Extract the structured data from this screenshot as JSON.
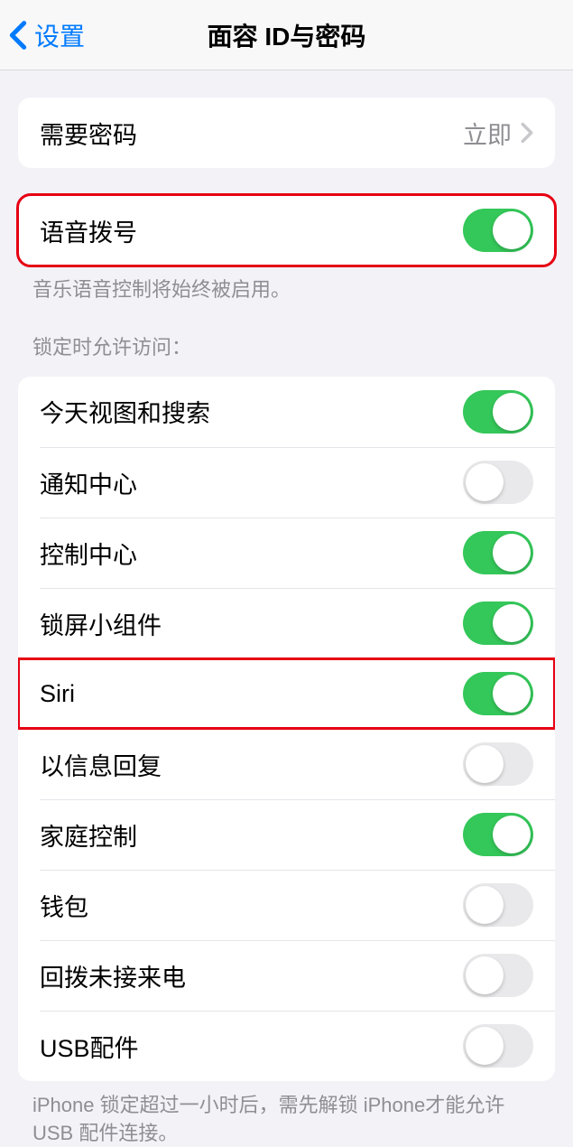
{
  "nav": {
    "back_label": "设置",
    "title": "面容 ID与密码"
  },
  "require_passcode": {
    "label": "需要密码",
    "value": "立即"
  },
  "voice_dial": {
    "label": "语音拨号",
    "enabled": true,
    "footer": "音乐语音控制将始终被启用。"
  },
  "lock_access": {
    "header": "锁定时允许访问：",
    "items": [
      {
        "label": "今天视图和搜索",
        "enabled": true
      },
      {
        "label": "通知中心",
        "enabled": false
      },
      {
        "label": "控制中心",
        "enabled": true
      },
      {
        "label": "锁屏小组件",
        "enabled": true
      },
      {
        "label": "Siri",
        "enabled": true,
        "highlighted": true
      },
      {
        "label": "以信息回复",
        "enabled": false
      },
      {
        "label": "家庭控制",
        "enabled": true
      },
      {
        "label": "钱包",
        "enabled": false
      },
      {
        "label": "回拨未接来电",
        "enabled": false
      },
      {
        "label": "USB配件",
        "enabled": false
      }
    ],
    "footer": "iPhone 锁定超过一小时后，需先解锁 iPhone才能允许 USB 配件连接。"
  }
}
